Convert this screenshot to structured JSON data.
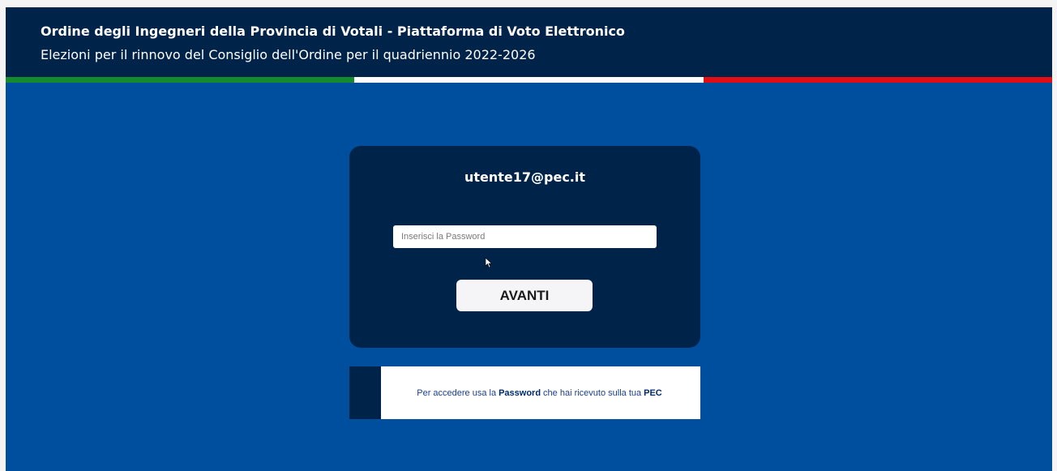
{
  "header": {
    "title": "Ordine degli Ingegneri della Provincia di Votali - Piattaforma di Voto Elettronico",
    "subtitle": "Elezioni per il rinnovo del Consiglio dell'Ordine per il quadriennio 2022-2026"
  },
  "flag": {
    "colors": [
      "#148b2f",
      "#ffffff",
      "#e10f14"
    ]
  },
  "login": {
    "email": "utente17@pec.it",
    "password_placeholder": "Inserisci la Password",
    "password_value": "",
    "submit_label": "AVANTI"
  },
  "info": {
    "prefix": "Per accedere usa la",
    "password_word": "Password",
    "middle": "che hai ricevuto sulla tua",
    "pec_word": "PEC"
  },
  "colors": {
    "header_bg": "#002349",
    "page_bg": "#004f9e",
    "card_bg": "#002349"
  }
}
